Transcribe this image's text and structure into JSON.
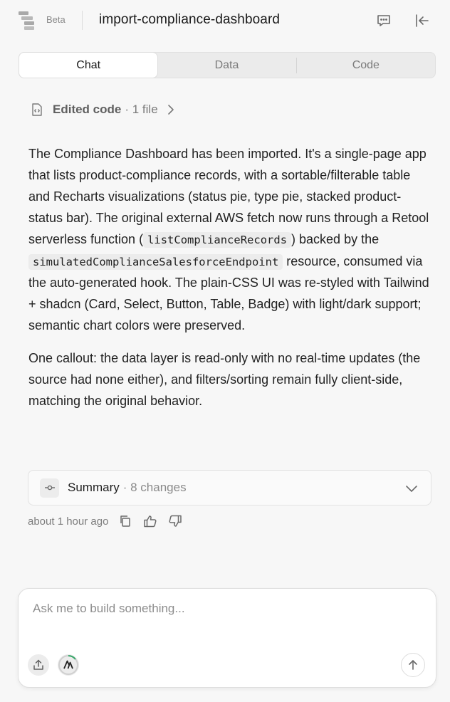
{
  "header": {
    "beta_label": "Beta",
    "title": "import-compliance-dashboard",
    "icons": [
      "logo-icon",
      "chat-bubble-icon",
      "collapse-panel-icon"
    ]
  },
  "tabs": [
    {
      "label": "Chat",
      "active": true
    },
    {
      "label": "Data",
      "active": false
    },
    {
      "label": "Code",
      "active": false
    }
  ],
  "edited": {
    "label": "Edited code",
    "count": "· 1 file"
  },
  "message": {
    "p1_a": "The Compliance Dashboard has been imported. It's a single-page app that lists product-compliance records, with a sortable/filterable table and Recharts visualizations (status pie, type pie, stacked product-status bar). The original external AWS fetch now runs through a Retool serverless function (",
    "code1": "listComplianceRecords",
    "p1_b": ") backed by the ",
    "code2": "simulatedComplianceSalesforceEndpoint",
    "p1_c": " resource, consumed via the auto-generated hook. The plain-CSS UI was re-styled with Tailwind + shadcn (Card, Select, Button, Table, Badge) with light/dark support; semantic chart colors were preserved.",
    "p2": "One callout: the data layer is read-only with no real-time updates (the source had none either), and filters/sorting remain fully client-side, matching the original behavior."
  },
  "summary": {
    "label": "Summary",
    "count": "· 8 changes"
  },
  "meta": {
    "time": "about 1 hour ago"
  },
  "composer": {
    "placeholder": "Ask me to build something..."
  },
  "colors": {
    "background": "#f7f7f7",
    "model_ring_accent": "#3aa86b"
  }
}
